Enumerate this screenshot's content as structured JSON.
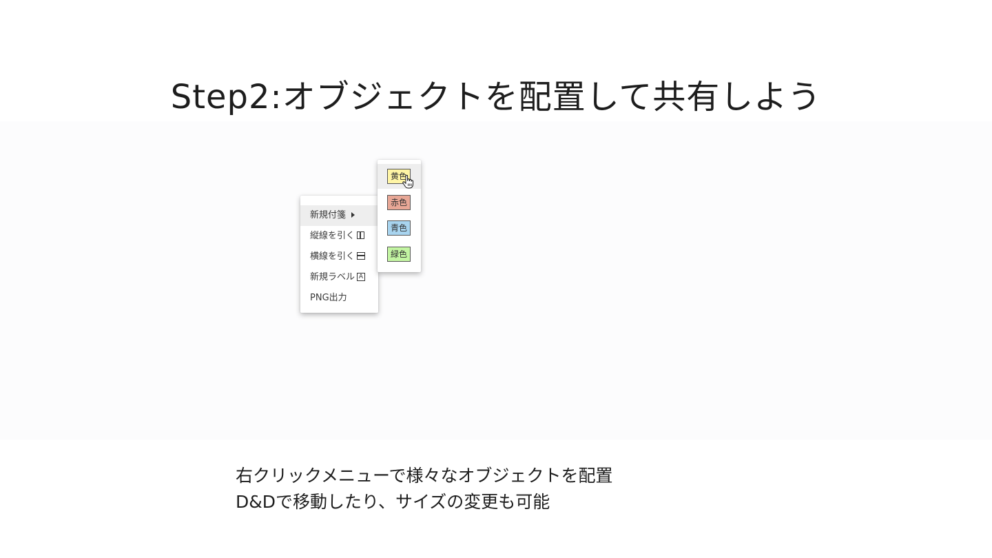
{
  "slide": {
    "title": "Step2:オブジェクトを配置して共有しよう",
    "caption_line1": "右クリックメニューで様々なオブジェクトを配置",
    "caption_line2": "D&Dで移動したり、サイズの変更も可能"
  },
  "context_menu": {
    "items": [
      {
        "label": "新規付箋",
        "icon": "submenu-arrow-icon"
      },
      {
        "label": "縦線を引く",
        "icon": "vertical-line-icon"
      },
      {
        "label": "横線を引く",
        "icon": "horizontal-line-icon"
      },
      {
        "label": "新規ラベル",
        "icon": "label-icon"
      },
      {
        "label": "PNG出力",
        "icon": ""
      }
    ],
    "label_icon_glyph": "A"
  },
  "submenu": {
    "items": [
      {
        "label": "黄色",
        "color": "#fff5a5"
      },
      {
        "label": "赤色",
        "color": "#e8a796"
      },
      {
        "label": "青色",
        "color": "#a8d4ef"
      },
      {
        "label": "緑色",
        "color": "#c3f5a2"
      }
    ]
  },
  "colors": {
    "canvas_bg": "#fcfcfd",
    "menu_hover": "#eeeeee"
  },
  "cursor": "hand-pointer-icon"
}
